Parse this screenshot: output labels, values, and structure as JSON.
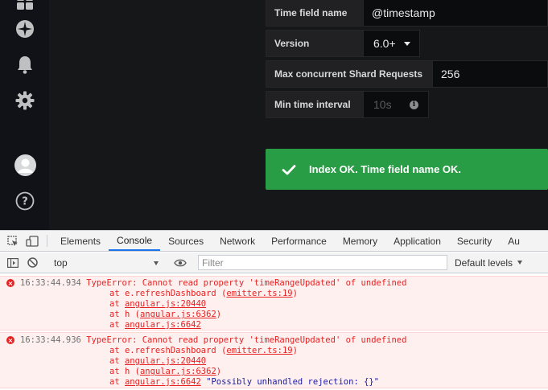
{
  "sidebar": {
    "icons": [
      "dashboards-icon",
      "explore-icon",
      "alerting-icon",
      "configuration-icon",
      "user-avatar",
      "help-icon"
    ]
  },
  "form": {
    "time_field": {
      "label": "Time field name",
      "value": "@timestamp"
    },
    "version": {
      "label": "Version",
      "value": "6.0+"
    },
    "max_shard": {
      "label": "Max concurrent Shard Requests",
      "value": "256"
    },
    "min_interval": {
      "label": "Min time interval",
      "placeholder": "10s"
    }
  },
  "alert": {
    "text": "Index OK. Time field name OK.",
    "color": "#299c46"
  },
  "devtools": {
    "tabs": [
      "Elements",
      "Console",
      "Sources",
      "Network",
      "Performance",
      "Memory",
      "Application",
      "Security",
      "Au"
    ],
    "active_tab": "Console",
    "context": "top",
    "filter_placeholder": "Filter",
    "levels": "Default levels",
    "messages": [
      {
        "time": "16:33:44.934",
        "text": "TypeError: Cannot read property 'timeRangeUpdated' of undefined",
        "stack": [
          {
            "prefix": "at e.refreshDashboard (",
            "link": "emitter.ts:19",
            "suffix": ")"
          },
          {
            "prefix": "at ",
            "link": "angular.js:20440",
            "suffix": ""
          },
          {
            "prefix": "at h (",
            "link": "angular.js:6362",
            "suffix": ")"
          },
          {
            "prefix": "at ",
            "link": "angular.js:6642",
            "suffix": ""
          }
        ]
      },
      {
        "time": "16:33:44.936",
        "text": "TypeError: Cannot read property 'timeRangeUpdated' of undefined",
        "stack": [
          {
            "prefix": "at e.refreshDashboard (",
            "link": "emitter.ts:19",
            "suffix": ")"
          },
          {
            "prefix": "at ",
            "link": "angular.js:20440",
            "suffix": ""
          },
          {
            "prefix": "at h (",
            "link": "angular.js:6362",
            "suffix": ")"
          },
          {
            "prefix": "at ",
            "link": "angular.js:6642",
            "suffix": ""
          }
        ],
        "extra": "\"Possibly unhandled rejection: {}\""
      }
    ]
  }
}
